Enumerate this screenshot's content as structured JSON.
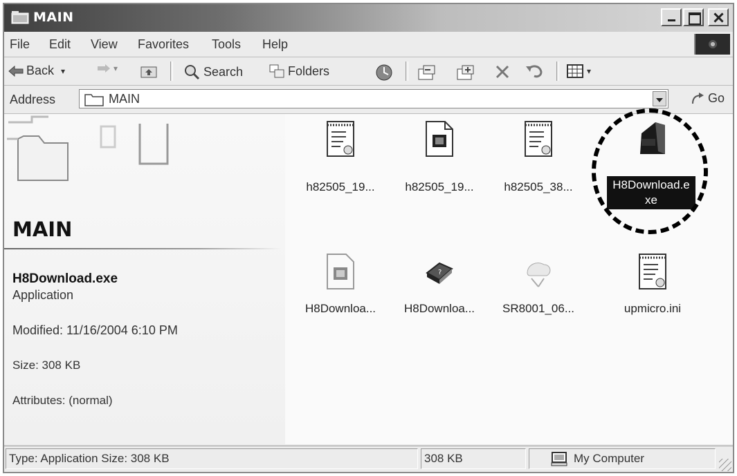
{
  "window": {
    "title": "MAIN"
  },
  "menu": [
    "File",
    "Edit",
    "View",
    "Favorites",
    "Tools",
    "Help"
  ],
  "toolbar": {
    "back": "Back",
    "search": "Search",
    "folders": "Folders"
  },
  "address": {
    "label": "Address",
    "value": "MAIN",
    "go": "Go"
  },
  "info_panel": {
    "folder_title": "MAIN",
    "selected_name": "H8Download.exe",
    "selected_type": "Application",
    "modified": "Modified: 11/16/2004 6:10 PM",
    "size": "Size: 308 KB",
    "attributes": "Attributes: (normal)"
  },
  "files": [
    {
      "label": "h82505_19...",
      "icon": "text-document-icon"
    },
    {
      "label": "h82505_19...",
      "icon": "binary-file-icon"
    },
    {
      "label": "h82505_38...",
      "icon": "text-document-icon"
    },
    {
      "label": "H8Download.e xe",
      "icon": "application-exe-icon",
      "selected": true
    },
    {
      "label": "H8Downloa...",
      "icon": "binary-file-icon"
    },
    {
      "label": "H8Downloa...",
      "icon": "help-book-icon"
    },
    {
      "label": "SR8001_06...",
      "icon": "network-file-icon"
    },
    {
      "label": "upmicro.ini",
      "icon": "ini-settings-icon"
    }
  ],
  "statusbar": {
    "info": "Type: Application Size: 308 KB",
    "size": "308 KB",
    "zone": "My Computer"
  }
}
